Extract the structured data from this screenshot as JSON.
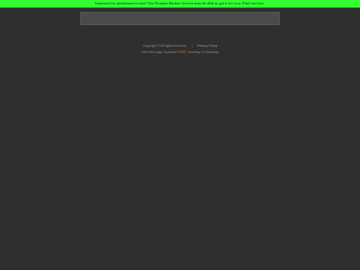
{
  "banner": {
    "text": "Interested in ",
    "domain": "jussthemesfi.com",
    "text2": "? Our Domain Broker Service may be able to get it for you. Find out how."
  },
  "footer": {
    "copyright": "Copyright ©  All rights reserved.",
    "privacy": "Privacy Policy",
    "separator": "|",
    "parked_prefix": "This Web page is parked",
    "parked_link": "FREE",
    "parked_suffix": ", courtesy of GoDaddy."
  },
  "colors": {
    "banner_bg": "#33ff33",
    "page_bg": "#2c2c2c",
    "accent": "#d2772a"
  }
}
